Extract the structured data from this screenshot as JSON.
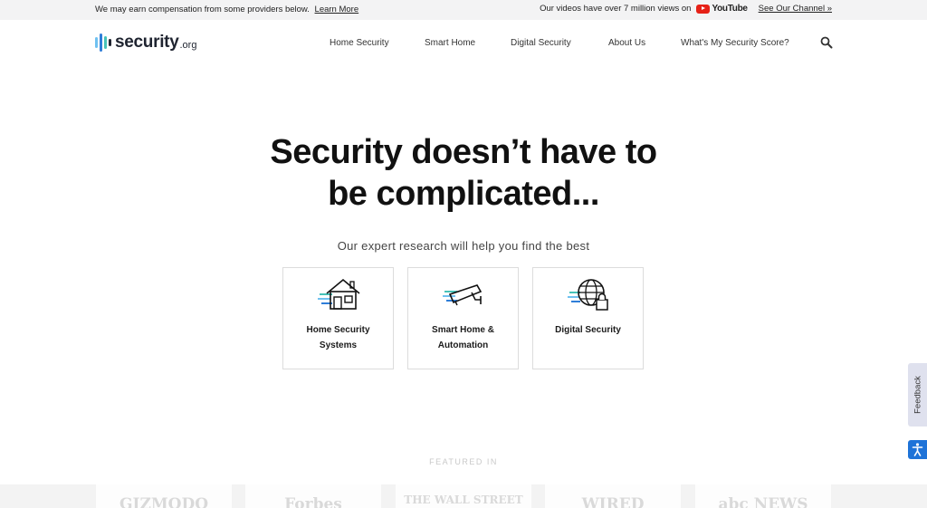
{
  "topbar": {
    "disclosure": "We may earn compensation from some providers below.",
    "learn_more": "Learn More",
    "videos": "Our videos have over 7 million views on",
    "youtube": "YouTube",
    "channel": "See Our Channel »"
  },
  "header": {
    "logo_text": "security",
    "logo_tld": ".org",
    "nav": [
      "Home Security",
      "Smart Home",
      "Digital Security",
      "About Us",
      "What's My Security Score?"
    ]
  },
  "hero": {
    "headline_line1": "Security doesn’t have to",
    "headline_line2": "be complicated...",
    "subheadline": "Our expert research will help you find the best"
  },
  "cards": [
    {
      "label_line1": "Home Security",
      "label_line2": "Systems",
      "icon": "house-icon"
    },
    {
      "label_line1": "Smart Home &",
      "label_line2": "Automation",
      "icon": "security-camera-icon"
    },
    {
      "label_line1": "Digital Security",
      "label_line2": "",
      "icon": "globe-lock-icon"
    }
  ],
  "widgets": {
    "feedback": "Feedback",
    "accessibility_icon": "accessibility-icon"
  },
  "featured": {
    "label": "FEATURED IN",
    "outlets": [
      "GIZMODO",
      "Forbes",
      "THE WALL STREET",
      "WIRED",
      "abc NEWS"
    ]
  },
  "colors": {
    "accent_blue": "#2f7ed8",
    "accent_teal": "#46c2b8",
    "youtube_red": "#e62117",
    "text_dark": "#111111"
  }
}
